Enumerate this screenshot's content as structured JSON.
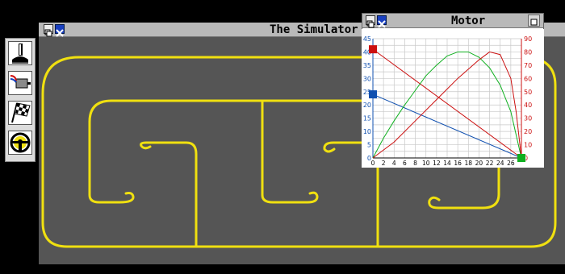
{
  "simulator": {
    "title": "The Simulator"
  },
  "motor": {
    "title": "Motor",
    "left_axis_ticks": [
      "0",
      "5",
      "10",
      "15",
      "20",
      "25",
      "30",
      "35",
      "40",
      "45"
    ],
    "right_axis_ticks": [
      "0",
      "10",
      "20",
      "30",
      "40",
      "50",
      "60",
      "70",
      "80",
      "90"
    ],
    "x_axis_ticks": [
      "0",
      "2",
      "4",
      "6",
      "8",
      "10",
      "12",
      "14",
      "16",
      "18",
      "20",
      "22",
      "24",
      "26"
    ]
  },
  "toolbar": {
    "tools": [
      {
        "icon": "joystick-icon"
      },
      {
        "icon": "motor-icon"
      },
      {
        "icon": "checkered-flag-icon"
      },
      {
        "icon": "steering-wheel-icon"
      }
    ]
  },
  "colors": {
    "track": "#f0e010",
    "track_bg": "#555555",
    "red_series": "#cc1010",
    "green_series": "#10b020",
    "blue_series": "#1050b0"
  },
  "chart_data": [
    {
      "type": "line",
      "title": "Motor",
      "xlim": [
        0,
        28
      ],
      "ylim_left": [
        0,
        45
      ],
      "ylim_right": [
        0,
        90
      ],
      "grid": true,
      "series": [
        {
          "axis": "left",
          "color": "#cc1010",
          "x": [
            0,
            28
          ],
          "y": [
            41,
            0
          ]
        },
        {
          "axis": "left",
          "color": "#1050b0",
          "x": [
            0,
            28
          ],
          "y": [
            24,
            0
          ]
        },
        {
          "axis": "right",
          "color": "#10b020",
          "x": [
            0,
            2,
            4,
            6,
            8,
            10,
            12,
            14,
            16,
            18,
            20,
            22,
            24,
            26,
            28
          ],
          "y": [
            0,
            15,
            28,
            40,
            51,
            62,
            70,
            77,
            80,
            80,
            76,
            68,
            55,
            35,
            0
          ]
        },
        {
          "axis": "right",
          "color": "#cc1010",
          "x": [
            0,
            4,
            8,
            12,
            16,
            20,
            22,
            24,
            26,
            27,
            28
          ],
          "y": [
            0,
            12,
            28,
            44,
            60,
            74,
            80,
            78,
            60,
            35,
            0
          ]
        }
      ],
      "markers": [
        {
          "axis": "left",
          "x": 0,
          "y": 41,
          "color": "#cc1010"
        },
        {
          "axis": "left",
          "x": 0,
          "y": 24,
          "color": "#1050b0"
        },
        {
          "axis": "left",
          "x": 28,
          "y": 0,
          "color": "#10b020"
        }
      ]
    }
  ]
}
